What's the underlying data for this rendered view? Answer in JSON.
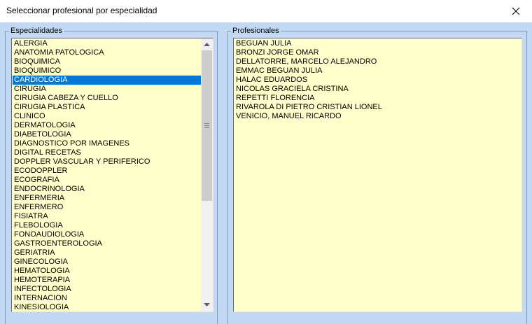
{
  "window": {
    "title": "Seleccionar profesional por especialidad"
  },
  "especialidades": {
    "legend": "Especialidades",
    "selected_index": 4,
    "items": [
      "ALERGIA",
      "ANATOMIA PATOLOGICA",
      "BIOQUIMICA",
      "BIOQUIMICO",
      "CARDIOLOGIA",
      "CIRUGIA",
      "CIRUGIA CABEZA Y CUELLO",
      "CIRUGIA PLASTICA",
      "CLINICO",
      "DERMATOLOGIA",
      "DIABETOLOGIA",
      "DIAGNOSTICO POR IMAGENES",
      "DIGITAL RECETAS",
      "DOPPLER VASCULAR Y PERIFERICO",
      "ECODOPPLER",
      "ECOGRAFIA",
      "ENDOCRINOLOGIA",
      "ENFERMERIA",
      "ENFERMERO",
      "FISIATRA",
      "FLEBOLOGIA",
      "FONOAUDIOLOGIA",
      "GASTROENTEROLOGIA",
      "GERIATRIA",
      "GINECOLOGIA",
      "HEMATOLOGIA",
      "HEMOTERAPIA",
      "INFECTOLOGIA",
      "INTERNACION",
      "KINESIOLOGIA"
    ]
  },
  "profesionales": {
    "legend": "Profesionales",
    "items": [
      "BEGUAN JULIA",
      "BRONZI JORGE OMAR",
      "DELLATORRE, MARCELO ALEJANDRO",
      "EMMAC BEGUAN JULIA",
      "HALAC EDUARDOS",
      "NICOLAS GRACIELA CRISTINA",
      "REPETTI FLORENCIA",
      "RIVAROLA DI PIETRO CRISTIAN LIONEL",
      "VENICIO, MANUEL RICARDO"
    ]
  },
  "icons": {
    "close": "close-icon",
    "scroll_up": "arrow-up-icon",
    "scroll_down": "arrow-down-icon",
    "grip": "scrollbar-grip-icon"
  },
  "colors": {
    "client_bg": "#c3d9f3",
    "list_bg": "#ffffcc",
    "selection": "#0078d7"
  }
}
